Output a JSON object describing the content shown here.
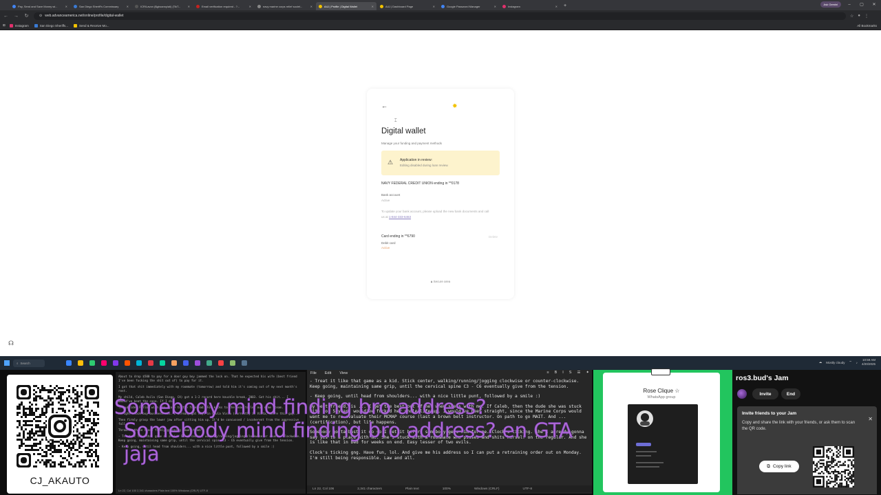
{
  "browser": {
    "tabs": [
      {
        "label": "Pay, Send and Save Money wi...",
        "color": "#4285f4",
        "active": false
      },
      {
        "label": "San Diego Sheriff's Commissary",
        "color": "#3a7bd5",
        "active": false
      },
      {
        "label": "ICR/Lavon ($giroanny/ali) (TikT...",
        "color": "#555555",
        "active": false
      },
      {
        "label": "Email verification required - ?...",
        "color": "#c5221f",
        "active": false
      },
      {
        "label": "navy marine corps relief societ...",
        "color": "#888888",
        "active": false
      },
      {
        "label": "A4J | Profile | Digital Wallet",
        "color": "#f2c200",
        "active": true
      },
      {
        "label": "A4J | Dashboard Page",
        "color": "#f2c200",
        "active": false
      },
      {
        "label": "Google Password Manager",
        "color": "#4285f4",
        "active": false
      },
      {
        "label": "Instagram",
        "color": "#e1306c",
        "active": false
      }
    ],
    "new_tab": "+",
    "account_label": "Ask Gemini",
    "url": "web.advanceamerica.net/online/profile/digital-wallet",
    "bookmarks": [
      {
        "label": "Instagram",
        "color": "#e1306c"
      },
      {
        "label": "San Diego Sheriffs...",
        "color": "#3a7bd5"
      },
      {
        "label": "Send & Receive Mo...",
        "color": "#f2c200"
      }
    ],
    "all_bookmarks": "All Bookmarks"
  },
  "wallet": {
    "title": "Digital wallet",
    "subtitle": "Manage your funding and payment methods",
    "review_title": "Application in review:",
    "review_sub": "Editing disabled during loan review.",
    "bank_name": "NAVY FEDERAL CREDIT UNION ending in **0178",
    "bank_type": "Bank account",
    "bank_status": "Active",
    "bank_note": "To update your bank account, please upload the new bank documents and call us at",
    "bank_phone": "1-844-333-6463",
    "card_name": "Card ending in **6790",
    "card_remove": "Delete",
    "card_type": "Debit card",
    "card_status": "Active",
    "secure": "Secure area"
  },
  "taskbar": {
    "search": "Search",
    "apps": [
      "#3a86ff",
      "#ffbe0b",
      "#2ecc71",
      "#ff006e",
      "#8338ec",
      "#ff5400",
      "#00b4d8",
      "#e63946",
      "#06d6a0",
      "#f4a261",
      "#4361ee",
      "#9d4edd",
      "#43aa8b",
      "#f94144",
      "#90be6d",
      "#577590"
    ],
    "weather": "Mostly cloudy",
    "time": "10:59 AM",
    "date": "4/20/2025"
  },
  "qr_card": {
    "handle": "CJ_AKAUTO"
  },
  "notes": {
    "paragraphs": [
      "About to drop $500 to pay for a door guy boy jammed the lock on. That he expected his wife (best friend I've been fucking the shit out of) to pay for it.",
      "I got that shit immediately with my roommate (tomorrow) and told him it's coming out of my next month's rent.",
      "My child, Caleb Avila (San Diego, CA) got a 1-2 record here knuckle break, 2003. Got his shit... I would've beat the case. If I did",
      "...subside. Follow with ice stone to the forehead. For kicks to the head to let out some steam.",
      "Alright block buy business out. I already got keys in Chula Vista (currently in Vista, where this guy...",
      "Then firmly grasp the lower jaw after sitting him up. It'd be concussed / incoherent from the aggressive fall.",
      "Throw... those hands firmly grasping lower head?",
      "- Treat it like that game as a kid. Stick center, walking/running/jogging clockwise or counter-clockwise. Keep going, maintaining same grip, until the cervical spine C3 - C6 eventually give from the tension.",
      "- Keep going, until head from shoulders... with a nice little punt, followed by a smile :)"
    ],
    "status": "Ln 22, Col 100   2,341 characters   Plain text   100%   Windows (CRLF)   UTF-8"
  },
  "editor": {
    "menu": [
      "File",
      "Edit",
      "View"
    ],
    "tools": [
      "≡",
      "B",
      "I",
      "S",
      "☰",
      "✦"
    ],
    "paragraphs": [
      "- Treat it like that game as a kid. Stick center, walking/running/jogging clockwise or counter-clockwise. Keep going, maintaining same grip, until the cervical spine C3 - C6 eventually give from the tension.",
      "- Keep going, until head from shoulders... with a nice little punt, followed by a smile :)",
      "My best friend, is ... I get the best out of her when she's with me. If Caleb, then the dude she was stuck with for 5 years would've fucked her whole life up. I would've been straight, since the Marine Corps would want me to re-evaluate their MCMAP course (last a brown belt instructor. On path to go MAIT. And ... (certification), but life happens.",
      "Somebody gotta bust it up so I get it before somebody gets him for me. Clock's ticking. She's already gonna say yes to a place with me. She's stuck with a roommate who pisses and shits herself on the regular. And she is like that in bed for weeks on end. Easy lesser of two evils.",
      "Clock's ticking gng. Have fun, lol. And give me his address so I can put a retraining order out on Monday. I'm still being responsible. Law and all."
    ],
    "status": {
      "position": "Ln 22, Col 106",
      "chars": "2,341 characters",
      "format": "Plain text",
      "zoom": "100%",
      "eol": "Windows (CRLF)",
      "encoding": "UTF-8"
    }
  },
  "chat_overlay": {
    "line1": "Somebody mind finding bro address?",
    "line2": "Somebody mind finding bro address? en GTA jaja"
  },
  "whatsapp": {
    "group_name": "Rose Clique ☆",
    "group_sub": "WhatsApp group"
  },
  "jam": {
    "title": "ros3.bud's Jam",
    "invite": "Invite",
    "end": "End",
    "panel_title": "Invite friends to your Jam",
    "panel_text": "Copy and share the link with your friends, or ask them to scan the QR code.",
    "copy_link": "Copy link"
  },
  "colors": {
    "accent_yellow": "#f2c200",
    "review_bg": "#fdf3cd",
    "overlay_purple": "#b06ad8",
    "green_screen": "#22c55e"
  }
}
